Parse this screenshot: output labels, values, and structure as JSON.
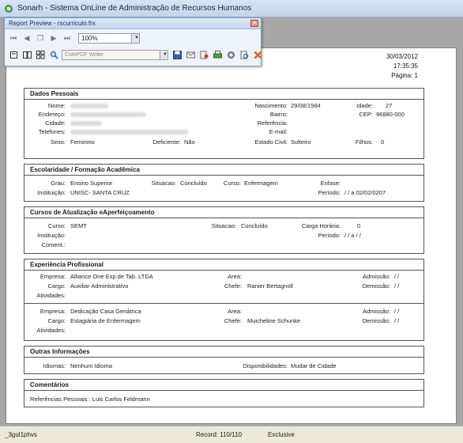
{
  "window": {
    "title": "Sonarh - Sistema OnLine de Administração de Recursos Humanos"
  },
  "preview": {
    "title": "Report Preview - rscurriculo.frx",
    "zoom": "100%",
    "printer": "CutePDF Writer",
    "icons": [
      "first-page-icon",
      "prev-page-icon",
      "copy-icon",
      "next-page-icon",
      "last-page-icon",
      "single-page-icon",
      "two-pages-icon",
      "multi-page-icon",
      "search-icon",
      "save-icon",
      "email-icon",
      "export-icon",
      "print-icon",
      "settings-icon",
      "page-setup-icon",
      "close-preview-icon"
    ]
  },
  "report": {
    "date": "30/03/2012",
    "time": "17:35:35",
    "page": "Página: 1",
    "dados": {
      "title": "Dados Pessoais",
      "nome_label": "Nome:",
      "endereco_label": "Endereço:",
      "cidade_label": "Cidade:",
      "telefones_label": "Telefones:",
      "sexo_label": "Sexo:",
      "sexo": "Feminino",
      "deficiente_label": "Deficiente:",
      "deficiente": "Não",
      "nascimento_label": "Nascimento:",
      "nascimento": "29/08/1984",
      "idade_label": "Idade:",
      "idade": "27",
      "bairro_label": "Bairro:",
      "cep_label": "CEP:",
      "cep": "96880-000",
      "referencia_label": "Referência:",
      "email_label": "E-mail:",
      "estado_civil_label": "Estado Civil:",
      "estado_civil": "Solteiro",
      "filhos_label": "Filhos:",
      "filhos": "0"
    },
    "escolaridade": {
      "title": "Escolaridade / Formação Acadêmica",
      "grau_label": "Grau:",
      "grau": "Ensino Superior",
      "situacao_label": "Situacao:",
      "situacao": "Concluído",
      "curso_label": "Curso:",
      "curso": "Enfermagem",
      "enfase_label": "Enfase:",
      "instituicao_label": "Instituição:",
      "instituicao": "UNISC- SANTA CRUZ",
      "periodo_label": "Período:",
      "periodo": "/ /     a 02/02/0207"
    },
    "atualizacao": {
      "title": "Cursos de Atualização eAperfeiçoamento",
      "curso_label": "Curso:",
      "curso": "SEMT",
      "situacao_label": "Situacao:",
      "situacao": "Concluído",
      "carga_label": "Carga Horária:",
      "carga": "0",
      "instituicao_label": "Instituição:",
      "periodo_label": "Período:",
      "periodo": "/ /     a   / /",
      "coment_label": "Coment.:"
    },
    "experiencia": {
      "title": "Experiência Profissional",
      "empresa_label": "Empresa:",
      "cargo_label": "Cargo:",
      "atividades_label": "Atividades:",
      "area_label": "Area:",
      "chefe_label": "Chefe:",
      "admissao_label": "Admissão:",
      "demissao_label": "Demissão:",
      "empty_date": "/ /",
      "items": [
        {
          "empresa": "Alliance One Exp.de Tab. LTDA",
          "cargo": "Auxiliar Administrativo",
          "chefe": "Ranier Bertagnoll"
        },
        {
          "empresa": "Dedicação Casa Geriátrica",
          "cargo": "Estagiária de Enfermagem",
          "chefe": "Muicheline Schunke"
        }
      ]
    },
    "outras": {
      "title": "Outras Informações",
      "idiomas_label": "Idiomas:",
      "idiomas": "Nenhum Idioma",
      "disponibilidades_label": "Disponibilidades:",
      "disponibilidades": "Mudar de Cidade"
    },
    "comentarios": {
      "title": "Comentários",
      "text": "Referências Pessoais : Luis Carlos Feldmann"
    }
  },
  "status": {
    "user": "_3gul1phvs",
    "record": "Record: 110/110",
    "mode": "Exclusive"
  },
  "colors": {
    "title_bar": "#c3d5ec",
    "background": "#a7a7a7",
    "page": "#ffffff",
    "close": "#e07560",
    "border": "#555555"
  }
}
